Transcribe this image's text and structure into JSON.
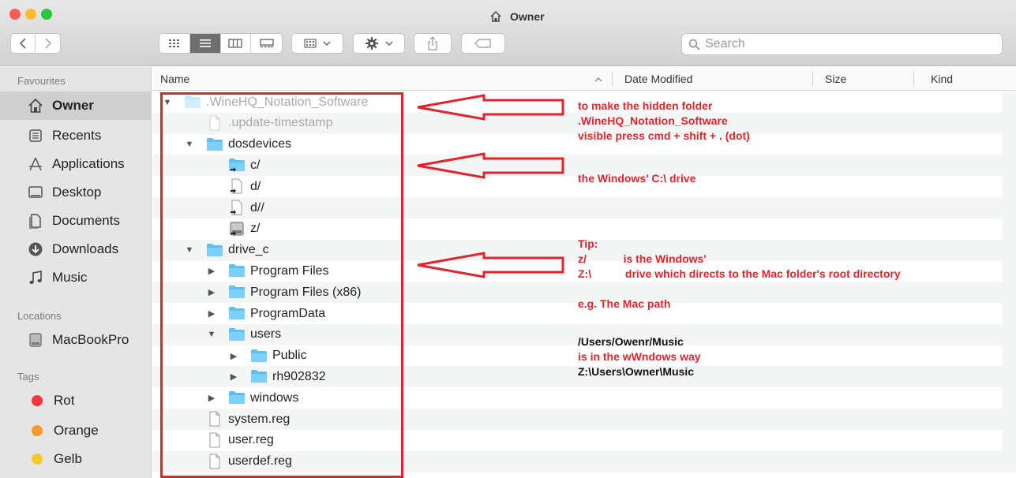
{
  "window": {
    "title": "Owner",
    "colors": {
      "close": "#fd5c57",
      "minimize": "#febb2d",
      "zoom": "#29c73f",
      "annotation": "#e0242b",
      "folder": "#5cc0f6"
    }
  },
  "toolbar": {
    "back_icon": "chevron-left-icon",
    "forward_icon": "chevron-right-icon",
    "views": [
      "icon-view",
      "list-view",
      "column-view",
      "gallery-view"
    ],
    "group_icon": "group-icon",
    "action_icon": "gear-icon",
    "share_icon": "share-icon",
    "tag_icon": "tag-icon",
    "search_placeholder": "Search"
  },
  "sidebar": {
    "favourites_heading": "Favourites",
    "favourites": [
      {
        "label": "Owner",
        "icon": "home-icon",
        "selected": true
      },
      {
        "label": "Recents",
        "icon": "recents-icon"
      },
      {
        "label": "Applications",
        "icon": "applications-icon"
      },
      {
        "label": "Desktop",
        "icon": "desktop-icon"
      },
      {
        "label": "Documents",
        "icon": "documents-icon"
      },
      {
        "label": "Downloads",
        "icon": "downloads-icon"
      },
      {
        "label": "Music",
        "icon": "music-icon"
      }
    ],
    "locations_heading": "Locations",
    "locations": [
      {
        "label": "MacBookPro",
        "icon": "disk-icon"
      }
    ],
    "tags_heading": "Tags",
    "tags": [
      {
        "label": "Rot",
        "color": "#f2383a"
      },
      {
        "label": "Orange",
        "color": "#f59a2b"
      },
      {
        "label": "Gelb",
        "color": "#f7c829"
      }
    ]
  },
  "columns": {
    "name": "Name",
    "date_modified": "Date Modified",
    "size": "Size",
    "kind": "Kind"
  },
  "files": [
    {
      "name": ".WineHQ_Notation_Software",
      "type": "folder",
      "expanded": true,
      "hidden": true
    },
    {
      "name": ".update-timestamp",
      "type": "file",
      "hidden": true
    },
    {
      "name": "dosdevices",
      "type": "folder",
      "expanded": true
    },
    {
      "name": "c/",
      "type": "alias-folder"
    },
    {
      "name": "d/",
      "type": "alias-file"
    },
    {
      "name": "d//",
      "type": "alias-file"
    },
    {
      "name": "z/",
      "type": "alias-disk"
    },
    {
      "name": "drive_c",
      "type": "folder",
      "expanded": true
    },
    {
      "name": "Program Files",
      "type": "folder",
      "expanded": false
    },
    {
      "name": "Program Files (x86)",
      "type": "folder",
      "expanded": false
    },
    {
      "name": "ProgramData",
      "type": "folder",
      "expanded": false
    },
    {
      "name": "users",
      "type": "folder",
      "expanded": true
    },
    {
      "name": "Public",
      "type": "folder",
      "expanded": false
    },
    {
      "name": "rh902832",
      "type": "folder",
      "expanded": false
    },
    {
      "name": "windows",
      "type": "folder",
      "expanded": false
    },
    {
      "name": "system.reg",
      "type": "file"
    },
    {
      "name": "user.reg",
      "type": "file"
    },
    {
      "name": "userdef.reg",
      "type": "file"
    }
  ],
  "annotations": {
    "note1": "to make the hidden folder\n.WineHQ_Notation_Software\nvisible press cmd + shift + . (dot)",
    "note2": "the Windows' C:\\ drive",
    "note3": "Tip:\nz/            is the Windows'\nZ:\\           drive which directs to the Mac folder's root directory\n\ne.g. The Mac path",
    "note4_path": "/Users/Owenr/Music",
    "note4_text": "is in the wWndows way",
    "note4_win": "Z:\\Users\\Owner\\Music"
  }
}
